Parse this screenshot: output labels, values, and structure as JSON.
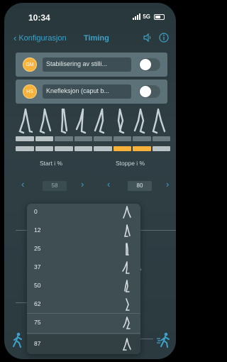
{
  "status": {
    "time": "10:34",
    "network": "5G"
  },
  "nav": {
    "back_label": "Konfigurasjon",
    "title": "Timing"
  },
  "muscles": [
    {
      "abbr": "GM",
      "label": "Stabilisering av stilli...",
      "enabled": false
    },
    {
      "abbr": "HS",
      "label": "Knefleksjon (caput b...",
      "enabled": false
    }
  ],
  "timing": {
    "start_label": "Start i %",
    "stop_label": "Stoppe i %",
    "start_value": "58",
    "stop_value": "80"
  },
  "background_letter": "A",
  "dropdown": {
    "options": [
      "0",
      "12",
      "25",
      "37",
      "50",
      "62",
      "75",
      "87"
    ],
    "selected": "87"
  },
  "colors": {
    "accent": "#3fa2c8",
    "badge": "#f6b23b",
    "active_segment": "#f6b23b"
  }
}
